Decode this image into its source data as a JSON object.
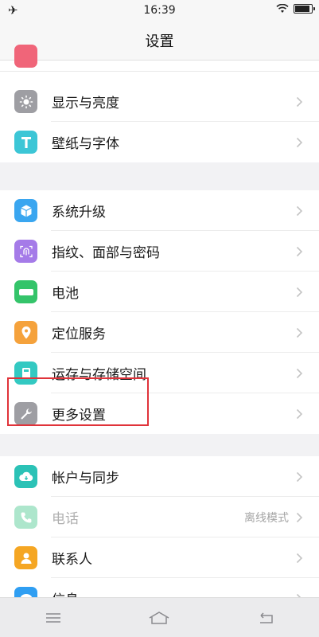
{
  "status_bar": {
    "time": "16:39",
    "airplane_icon": "airplane-icon",
    "wifi_icon": "wifi-icon",
    "battery_icon": "battery-icon"
  },
  "header": {
    "title": "设置"
  },
  "groups": [
    {
      "items": [
        {
          "label": "显示与亮度",
          "icon": "brightness-icon",
          "icon_color": "#9e9ea3"
        },
        {
          "label": "壁纸与字体",
          "icon": "font-t-icon",
          "icon_color": "#3cc6d6"
        }
      ]
    },
    {
      "items": [
        {
          "label": "系统升级",
          "icon": "system-update-icon",
          "icon_color": "#3aa6f0"
        },
        {
          "label": "指纹、面部与密码",
          "icon": "fingerprint-icon",
          "icon_color": "#a57be8"
        },
        {
          "label": "电池",
          "icon": "battery-setting-icon",
          "icon_color": "#34c46a"
        },
        {
          "label": "定位服务",
          "icon": "location-icon",
          "icon_color": "#f5a23c"
        },
        {
          "label": "运存与存储空间",
          "icon": "storage-icon",
          "icon_color": "#33c9c2"
        },
        {
          "label": "更多设置",
          "icon": "wrench-icon",
          "icon_color": "#9e9ea3"
        }
      ]
    },
    {
      "items": [
        {
          "label": "帐户与同步",
          "icon": "cloud-sync-icon",
          "icon_color": "#2bc2b6"
        },
        {
          "label": "电话",
          "value": "离线模式",
          "icon": "phone-icon",
          "icon_color": "#4cc990",
          "disabled": true
        },
        {
          "label": "联系人",
          "icon": "contacts-icon",
          "icon_color": "#f5a623"
        },
        {
          "label": "信息",
          "icon": "message-icon",
          "icon_color": "#2f9ef2"
        }
      ]
    }
  ],
  "nav": {
    "menu_icon": "menu-icon",
    "home_icon": "home-icon",
    "back_icon": "back-icon"
  },
  "colors": {
    "highlight": "#e0333a",
    "chevron": "#c4c4c4",
    "value_text": "#a5a5a5"
  }
}
